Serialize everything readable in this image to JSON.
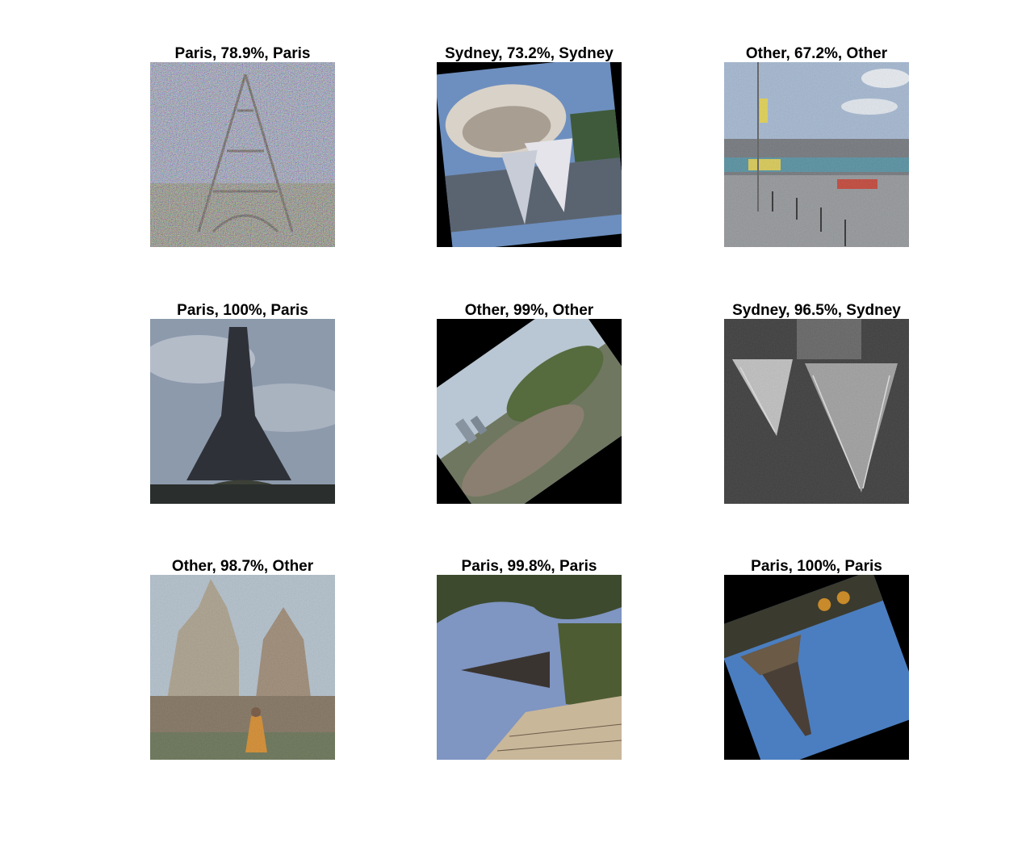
{
  "panels": [
    {
      "title": "Paris, 78.9%, Paris",
      "scene": "eiffel-tower-noisy"
    },
    {
      "title": "Sydney, 73.2%, Sydney",
      "scene": "sydney-opera-house-rotated"
    },
    {
      "title": "Other, 67.2%, Other",
      "scene": "stadium-street"
    },
    {
      "title": "Paris, 100%, Paris",
      "scene": "eiffel-tower-cloudy"
    },
    {
      "title": "Other, 99%, Other",
      "scene": "hillside-trees-rotated"
    },
    {
      "title": "Sydney, 96.5%, Sydney",
      "scene": "opera-house-interior-grayscale"
    },
    {
      "title": "Other, 98.7%, Other",
      "scene": "temple-ruins-monk"
    },
    {
      "title": "Paris, 99.8%, Paris",
      "scene": "eiffel-tower-sideways"
    },
    {
      "title": "Paris, 100%, Paris",
      "scene": "eiffel-tower-upside-down-rotated"
    }
  ]
}
